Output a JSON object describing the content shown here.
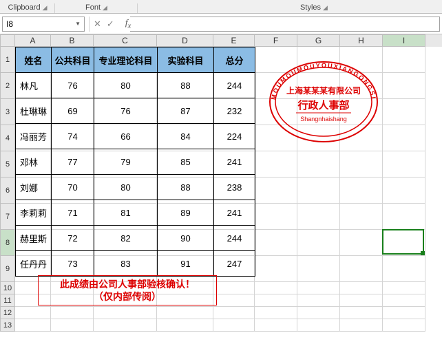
{
  "ribbon": {
    "groups": [
      "Clipboard",
      "Font",
      "Styles"
    ]
  },
  "namebox": "I8",
  "colHeaders": [
    "A",
    "B",
    "C",
    "D",
    "E",
    "F",
    "G",
    "H",
    "I"
  ],
  "rowCount": 13,
  "selectedCol": 8,
  "selectedRow": 8,
  "activeCell": {
    "row": 8,
    "col": 8
  },
  "table": {
    "headers": [
      "姓名",
      "公共科目",
      "专业理论科目",
      "实验科目",
      "总分"
    ],
    "rows": [
      [
        "林凡",
        "76",
        "80",
        "88",
        "244"
      ],
      [
        "杜琳琳",
        "69",
        "76",
        "87",
        "232"
      ],
      [
        "冯丽芳",
        "74",
        "66",
        "84",
        "224"
      ],
      [
        "邓林",
        "77",
        "79",
        "85",
        "241"
      ],
      [
        "刘娜",
        "70",
        "80",
        "88",
        "238"
      ],
      [
        "李莉莉",
        "71",
        "81",
        "89",
        "241"
      ],
      [
        "赫里斯",
        "72",
        "82",
        "90",
        "244"
      ],
      [
        "任丹丹",
        "73",
        "83",
        "91",
        "247"
      ]
    ]
  },
  "note": {
    "line1": "此成绩由公司人事部验核确认！",
    "line2": "（仅内部传阅）"
  },
  "stamp": {
    "outer": "MOUMOUMOUYOUXIANGONGSI",
    "line1": "上海某某某有限公司",
    "line2": "行政人事部",
    "line3": "Shangnhaishang"
  },
  "chart_data": {
    "type": "table",
    "title": "成绩表",
    "columns": [
      "姓名",
      "公共科目",
      "专业理论科目",
      "实验科目",
      "总分"
    ],
    "rows": [
      {
        "姓名": "林凡",
        "公共科目": 76,
        "专业理论科目": 80,
        "实验科目": 88,
        "总分": 244
      },
      {
        "姓名": "杜琳琳",
        "公共科目": 69,
        "专业理论科目": 76,
        "实验科目": 87,
        "总分": 232
      },
      {
        "姓名": "冯丽芳",
        "公共科目": 74,
        "专业理论科目": 66,
        "实验科目": 84,
        "总分": 224
      },
      {
        "姓名": "邓林",
        "公共科目": 77,
        "专业理论科目": 79,
        "实验科目": 85,
        "总分": 241
      },
      {
        "姓名": "刘娜",
        "公共科目": 70,
        "专业理论科目": 80,
        "实验科目": 88,
        "总分": 238
      },
      {
        "姓名": "李莉莉",
        "公共科目": 71,
        "专业理论科目": 81,
        "实验科目": 89,
        "总分": 241
      },
      {
        "姓名": "赫里斯",
        "公共科目": 72,
        "专业理论科目": 82,
        "实验科目": 90,
        "总分": 244
      },
      {
        "姓名": "任丹丹",
        "公共科目": 73,
        "专业理论科目": 83,
        "实验科目": 91,
        "总分": 247
      }
    ]
  }
}
